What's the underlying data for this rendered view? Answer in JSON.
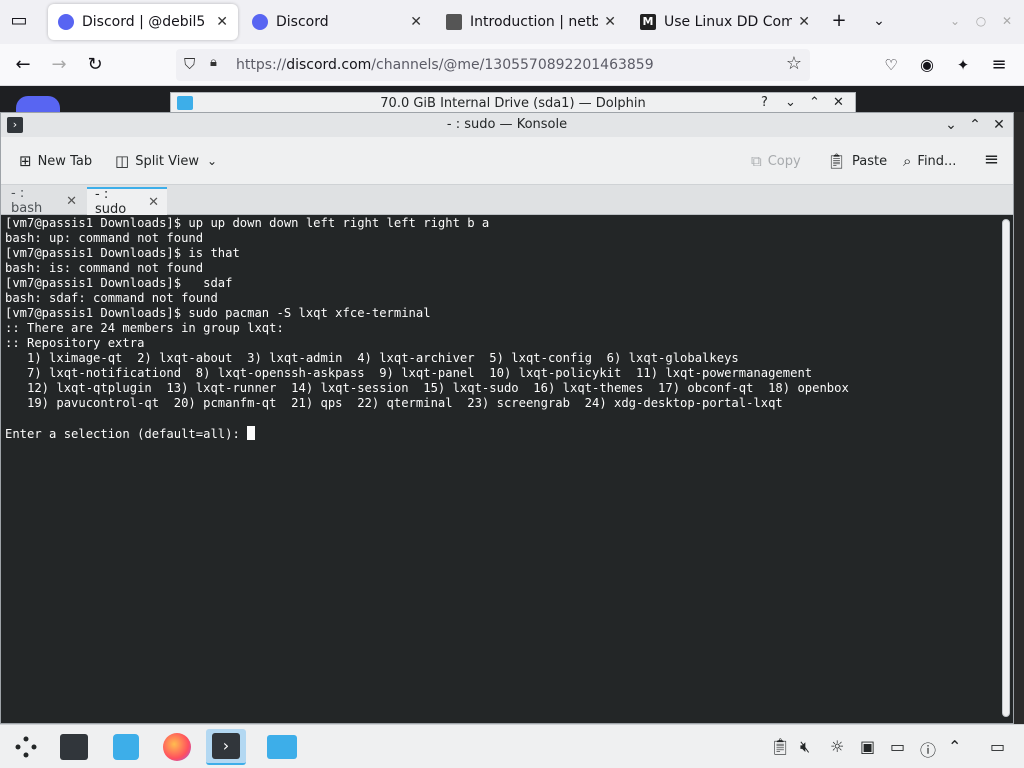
{
  "browser": {
    "tabs": [
      {
        "label": "Discord | @debil5",
        "close": "✕",
        "icon": "discord-icon"
      },
      {
        "label": "Discord",
        "close": "✕",
        "icon": "discord-icon"
      },
      {
        "label": "Introduction | netbo",
        "close": "✕",
        "icon": "page-icon"
      },
      {
        "label": "Use Linux DD Comm",
        "close": "✕",
        "icon": "medium-icon"
      }
    ],
    "new_tab": "+",
    "url_prefix": "https://",
    "url_domain": "discord.com",
    "url_path": "/channels/@me/1305570892201463859"
  },
  "dolphin": {
    "title": "70.0 GiB Internal Drive (sda1) — Dolphin",
    "help": "?"
  },
  "konsole": {
    "title": "- : sudo — Konsole",
    "toolbar": {
      "new_tab": "New Tab",
      "split_view": "Split View",
      "copy": "Copy",
      "paste": "Paste",
      "find": "Find..."
    },
    "tabs": [
      {
        "label": "- : bash",
        "close": "✕"
      },
      {
        "label": "- : sudo",
        "close": "✕"
      }
    ],
    "terminal_lines": [
      "[vm7@passis1 Downloads]$ up up down down left right left right b a",
      "bash: up: command not found",
      "[vm7@passis1 Downloads]$ is that",
      "bash: is: command not found",
      "[vm7@passis1 Downloads]$   sdaf",
      "bash: sdaf: command not found",
      "[vm7@passis1 Downloads]$ sudo pacman -S lxqt xfce-terminal",
      ":: There are 24 members in group lxqt:",
      ":: Repository extra",
      "   1) lximage-qt  2) lxqt-about  3) lxqt-admin  4) lxqt-archiver  5) lxqt-config  6) lxqt-globalkeys",
      "   7) lxqt-notificationd  8) lxqt-openssh-askpass  9) lxqt-panel  10) lxqt-policykit  11) lxqt-powermanagement",
      "   12) lxqt-qtplugin  13) lxqt-runner  14) lxqt-session  15) lxqt-sudo  16) lxqt-themes  17) obconf-qt  18) openbox",
      "   19) pavucontrol-qt  20) pcmanfm-qt  21) qps  22) qterminal  23) screengrab  24) xdg-desktop-portal-lxqt",
      "",
      "Enter a selection (default=all): "
    ]
  },
  "taskbar": {
    "apps": [
      "app-launcher",
      "system-settings",
      "discover",
      "firefox",
      "konsole",
      "dolphin"
    ],
    "active_app": "konsole"
  }
}
